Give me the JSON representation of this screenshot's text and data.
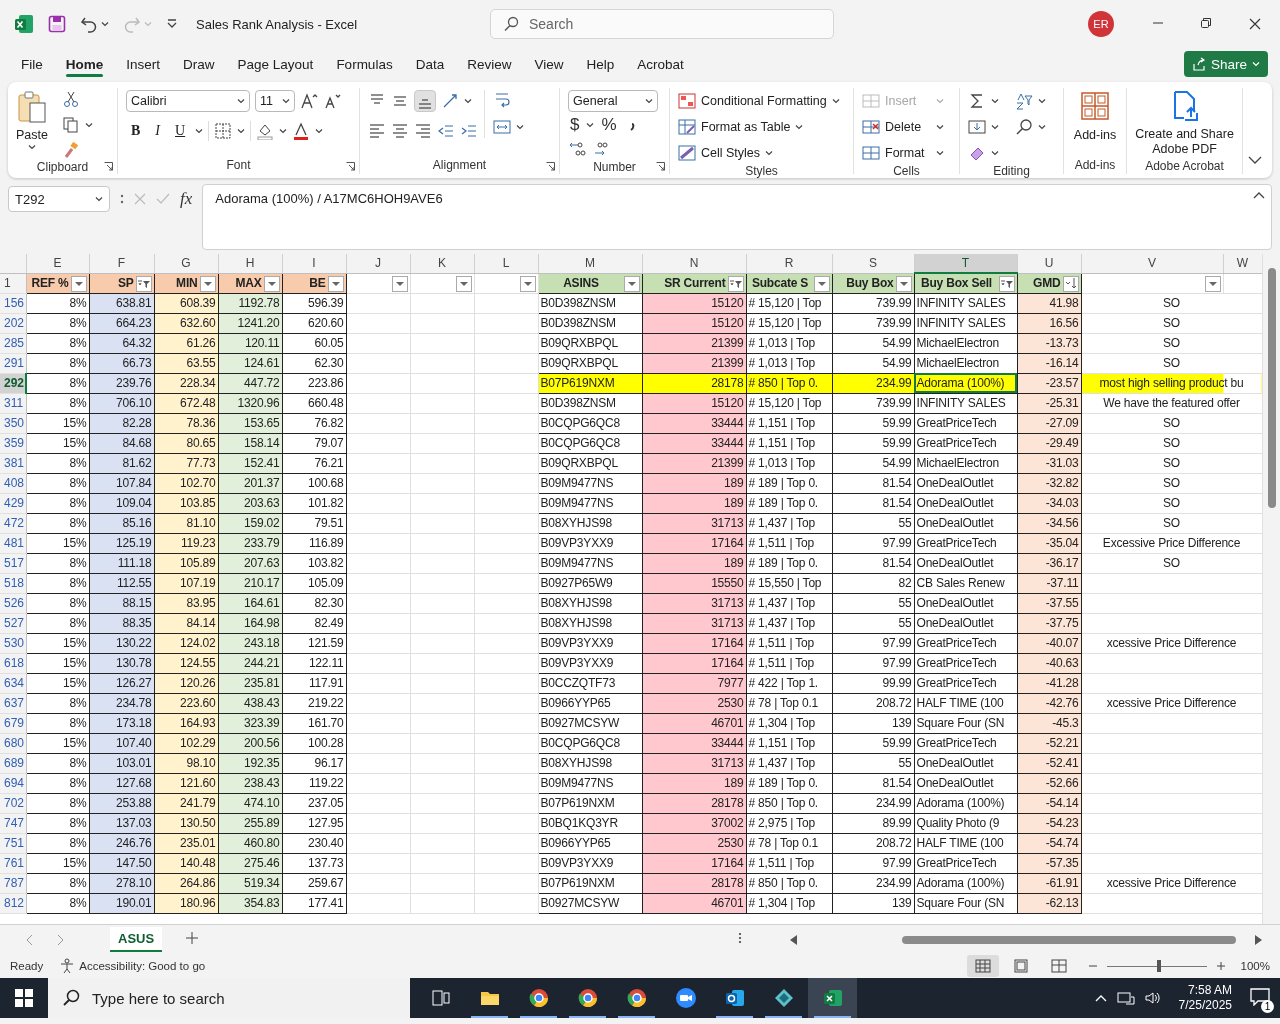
{
  "titlebar": {
    "title": "Sales Rank Analysis - Excel",
    "undo": {
      "disabled": false
    },
    "redo": {
      "disabled": true
    },
    "search_placeholder": "Search",
    "avatar": "ER"
  },
  "tabs": [
    {
      "label": "File",
      "selected": false
    },
    {
      "label": "Home",
      "selected": true
    },
    {
      "label": "Insert",
      "selected": false
    },
    {
      "label": "Draw",
      "selected": false
    },
    {
      "label": "Page Layout",
      "selected": false
    },
    {
      "label": "Formulas",
      "selected": false
    },
    {
      "label": "Data",
      "selected": false
    },
    {
      "label": "Review",
      "selected": false
    },
    {
      "label": "View",
      "selected": false
    },
    {
      "label": "Help",
      "selected": false
    },
    {
      "label": "Acrobat",
      "selected": false
    }
  ],
  "share": "Share",
  "ribbon": {
    "clipboard": {
      "label": "Clipboard",
      "paste": "Paste"
    },
    "font": {
      "label": "Font",
      "name": "Calibri",
      "size": "11",
      "bold": "B",
      "italic": "I",
      "underline": "U"
    },
    "alignment": {
      "label": "Alignment"
    },
    "number": {
      "label": "Number",
      "format": "General",
      "currency": "$",
      "percent": "%"
    },
    "styles": {
      "label": "Styles",
      "items": [
        "Conditional Formatting",
        "Format as Table",
        "Cell Styles"
      ]
    },
    "cells": {
      "label": "Cells",
      "items": [
        {
          "label": "Insert",
          "disabled": true
        },
        {
          "label": "Delete",
          "disabled": false
        },
        {
          "label": "Format",
          "disabled": false
        }
      ]
    },
    "editing": {
      "label": "Editing"
    },
    "addins": {
      "label": "Add-ins",
      "button": "Add-ins"
    },
    "acrobat": {
      "label": "Adobe Acrobat",
      "button": "Create and Share Adobe PDF"
    }
  },
  "formula_bar": {
    "name_box": "T292",
    "function_label": "fx",
    "formula": "Adorama (100%) / A17MC6HOH9AVE6"
  },
  "sheet": {
    "header_row": "1",
    "column_groups": [
      {
        "color": "#f8cbad",
        "columns": [
          {
            "letter": "E",
            "header": "REF %",
            "kind": "number",
            "filterable": true,
            "filtered": false,
            "sorted": false,
            "highlightable": false,
            "selected": false
          },
          {
            "letter": "F",
            "header": "SP",
            "kind": "number",
            "filterable": true,
            "filtered": true,
            "sorted": false,
            "color": "#d9e1f2",
            "highlightable": false,
            "selected": false
          },
          {
            "letter": "G",
            "header": "MIN",
            "kind": "number",
            "filterable": true,
            "filtered": false,
            "sorted": false,
            "color": "#fff2cc",
            "highlightable": false,
            "selected": false
          },
          {
            "letter": "H",
            "header": "MAX",
            "kind": "number",
            "filterable": true,
            "filtered": false,
            "sorted": false,
            "color": "#e2efda",
            "highlightable": false,
            "selected": false
          },
          {
            "letter": "I",
            "header": "BE",
            "kind": "number",
            "filterable": true,
            "filtered": false,
            "sorted": false,
            "highlightable": false,
            "selected": false
          }
        ]
      },
      {
        "columns": [
          {
            "letter": "J",
            "kind": "empty",
            "filterable": true,
            "filtered": false,
            "sorted": false,
            "highlightable": false,
            "selected": false
          },
          {
            "letter": "K",
            "kind": "empty",
            "filterable": true,
            "filtered": false,
            "sorted": false,
            "highlightable": false,
            "selected": false
          },
          {
            "letter": "L",
            "kind": "empty",
            "filterable": true,
            "filtered": false,
            "sorted": false,
            "highlightable": false,
            "selected": false
          }
        ]
      },
      {
        "color": "#c6e0b4",
        "columns": [
          {
            "letter": "M",
            "header": "ASINS",
            "kind": "text",
            "filterable": true,
            "filtered": false,
            "sorted": false,
            "highlightable": true,
            "selected": false
          },
          {
            "letter": "N",
            "header": "SR Current",
            "kind": "number",
            "filterable": true,
            "filtered": true,
            "sorted": false,
            "color": "#ffc7ce",
            "highlightable": true,
            "selected": false
          },
          {
            "letter": "R",
            "header": "Subcate S",
            "kind": "text",
            "filterable": true,
            "filtered": false,
            "sorted": false,
            "highlightable": true,
            "selected": false
          },
          {
            "letter": "S",
            "header": "Buy Box",
            "kind": "number",
            "filterable": true,
            "filtered": false,
            "sorted": false,
            "highlightable": true,
            "selected": false
          },
          {
            "letter": "T",
            "header": "Buy Box Sell",
            "kind": "text",
            "filterable": true,
            "filtered": true,
            "sorted": false,
            "highlightable": true,
            "selected": true
          },
          {
            "letter": "U",
            "header": "GMD",
            "kind": "number",
            "filterable": true,
            "filtered": false,
            "sorted": true,
            "color": "#fce4d6",
            "highlightable": false,
            "selected": false
          }
        ]
      },
      {
        "columns": [
          {
            "letter": "V",
            "kind": "note",
            "filterable": true,
            "filtered": false,
            "sorted": false,
            "highlightable": true,
            "selected": false
          },
          {
            "letter": "W",
            "kind": "empty",
            "filterable": false,
            "selected": false
          }
        ]
      }
    ],
    "rows": [
      {
        "row": "156",
        "cells": [
          "8%",
          "638.81",
          "608.39",
          "1192.78",
          "596.39",
          "",
          "",
          "",
          "B0D398ZNSM",
          "15120",
          "# 15,120 | Top",
          "739.99",
          "INFINITY SALES",
          "41.98",
          "SO"
        ],
        "highlighted": false,
        "selected": false
      },
      {
        "row": "202",
        "cells": [
          "8%",
          "664.23",
          "632.60",
          "1241.20",
          "620.60",
          "",
          "",
          "",
          "B0D398ZNSM",
          "15120",
          "# 15,120 | Top",
          "739.99",
          "INFINITY SALES",
          "16.56",
          "SO"
        ],
        "highlighted": false,
        "selected": false
      },
      {
        "row": "285",
        "cells": [
          "8%",
          "64.32",
          "61.26",
          "120.11",
          "60.05",
          "",
          "",
          "",
          "B09QRXBPQL",
          "21399",
          "# 1,013 | Top",
          "54.99",
          "MichaelElectron",
          "-13.73",
          "SO"
        ],
        "highlighted": false,
        "selected": false
      },
      {
        "row": "291",
        "cells": [
          "8%",
          "66.73",
          "63.55",
          "124.61",
          "62.30",
          "",
          "",
          "",
          "B09QRXBPQL",
          "21399",
          "# 1,013 | Top",
          "54.99",
          "MichaelElectron",
          "-16.14",
          "SO"
        ],
        "highlighted": false,
        "selected": false
      },
      {
        "row": "292",
        "cells": [
          "8%",
          "239.76",
          "228.34",
          "447.72",
          "223.86",
          "",
          "",
          "",
          "B07P619NXM",
          "28178",
          "# 850 | Top 0.",
          "234.99",
          "Adorama (100%)",
          "-23.57",
          "most high selling product bu"
        ],
        "highlighted": true,
        "selected": true
      },
      {
        "row": "311",
        "cells": [
          "8%",
          "706.10",
          "672.48",
          "1320.96",
          "660.48",
          "",
          "",
          "",
          "B0D398ZNSM",
          "15120",
          "# 15,120 | Top",
          "739.99",
          "INFINITY SALES",
          "-25.31",
          "We have the featured offer"
        ],
        "highlighted": false,
        "selected": false
      },
      {
        "row": "350",
        "cells": [
          "15%",
          "82.28",
          "78.36",
          "153.65",
          "76.82",
          "",
          "",
          "",
          "B0CQPG6QC8",
          "33444",
          "# 1,151 | Top",
          "59.99",
          "GreatPriceTech",
          "-27.09",
          "SO"
        ],
        "highlighted": false,
        "selected": false
      },
      {
        "row": "359",
        "cells": [
          "15%",
          "84.68",
          "80.65",
          "158.14",
          "79.07",
          "",
          "",
          "",
          "B0CQPG6QC8",
          "33444",
          "# 1,151 | Top",
          "59.99",
          "GreatPriceTech",
          "-29.49",
          "SO"
        ],
        "highlighted": false,
        "selected": false
      },
      {
        "row": "381",
        "cells": [
          "8%",
          "81.62",
          "77.73",
          "152.41",
          "76.21",
          "",
          "",
          "",
          "B09QRXBPQL",
          "21399",
          "# 1,013 | Top",
          "54.99",
          "MichaelElectron",
          "-31.03",
          "SO"
        ],
        "highlighted": false,
        "selected": false
      },
      {
        "row": "408",
        "cells": [
          "8%",
          "107.84",
          "102.70",
          "201.37",
          "100.68",
          "",
          "",
          "",
          "B09M9477NS",
          "189",
          "# 189 | Top 0.",
          "81.54",
          "OneDealOutlet",
          "-32.82",
          "SO"
        ],
        "highlighted": false,
        "selected": false
      },
      {
        "row": "429",
        "cells": [
          "8%",
          "109.04",
          "103.85",
          "203.63",
          "101.82",
          "",
          "",
          "",
          "B09M9477NS",
          "189",
          "# 189 | Top 0.",
          "81.54",
          "OneDealOutlet",
          "-34.03",
          "SO"
        ],
        "highlighted": false,
        "selected": false
      },
      {
        "row": "472",
        "cells": [
          "8%",
          "85.16",
          "81.10",
          "159.02",
          "79.51",
          "",
          "",
          "",
          "B08XYHJS98",
          "31713",
          "# 1,437 | Top",
          "55",
          "OneDealOutlet",
          "-34.56",
          "SO"
        ],
        "highlighted": false,
        "selected": false
      },
      {
        "row": "481",
        "cells": [
          "15%",
          "125.19",
          "119.23",
          "233.79",
          "116.89",
          "",
          "",
          "",
          "B09VP3YXX9",
          "17164",
          "# 1,511 | Top",
          "97.99",
          "GreatPriceTech",
          "-35.04",
          "Excessive Price Difference"
        ],
        "highlighted": false,
        "selected": false
      },
      {
        "row": "517",
        "cells": [
          "8%",
          "111.18",
          "105.89",
          "207.63",
          "103.82",
          "",
          "",
          "",
          "B09M9477NS",
          "189",
          "# 189 | Top 0.",
          "81.54",
          "OneDealOutlet",
          "-36.17",
          "SO"
        ],
        "highlighted": false,
        "selected": false
      },
      {
        "row": "518",
        "cells": [
          "8%",
          "112.55",
          "107.19",
          "210.17",
          "105.09",
          "",
          "",
          "",
          "B0927P65W9",
          "15550",
          "# 15,550 | Top",
          "82",
          "CB Sales Renew",
          "-37.11",
          ""
        ],
        "highlighted": false,
        "selected": false
      },
      {
        "row": "526",
        "cells": [
          "8%",
          "88.15",
          "83.95",
          "164.61",
          "82.30",
          "",
          "",
          "",
          "B08XYHJS98",
          "31713",
          "# 1,437 | Top",
          "55",
          "OneDealOutlet",
          "-37.55",
          ""
        ],
        "highlighted": false,
        "selected": false
      },
      {
        "row": "527",
        "cells": [
          "8%",
          "88.35",
          "84.14",
          "164.98",
          "82.49",
          "",
          "",
          "",
          "B08XYHJS98",
          "31713",
          "# 1,437 | Top",
          "55",
          "OneDealOutlet",
          "-37.75",
          ""
        ],
        "highlighted": false,
        "selected": false
      },
      {
        "row": "530",
        "cells": [
          "15%",
          "130.22",
          "124.02",
          "243.18",
          "121.59",
          "",
          "",
          "",
          "B09VP3YXX9",
          "17164",
          "# 1,511 | Top",
          "97.99",
          "GreatPriceTech",
          "-40.07",
          "xcessive Price Difference"
        ],
        "highlighted": false,
        "selected": false
      },
      {
        "row": "618",
        "cells": [
          "15%",
          "130.78",
          "124.55",
          "244.21",
          "122.11",
          "",
          "",
          "",
          "B09VP3YXX9",
          "17164",
          "# 1,511 | Top",
          "97.99",
          "GreatPriceTech",
          "-40.63",
          ""
        ],
        "highlighted": false,
        "selected": false
      },
      {
        "row": "634",
        "cells": [
          "15%",
          "126.27",
          "120.26",
          "235.81",
          "117.91",
          "",
          "",
          "",
          "B0CCZQTF73",
          "7977",
          "# 422 | Top 1.",
          "99.99",
          "GreatPriceTech",
          "-41.28",
          ""
        ],
        "highlighted": false,
        "selected": false
      },
      {
        "row": "637",
        "cells": [
          "8%",
          "234.78",
          "223.60",
          "438.43",
          "219.22",
          "",
          "",
          "",
          "B0966YYP65",
          "2530",
          "# 78 | Top 0.1",
          "208.72",
          "HALF TIME (100",
          "-42.76",
          "xcessive Price Difference"
        ],
        "highlighted": false,
        "selected": false
      },
      {
        "row": "679",
        "cells": [
          "8%",
          "173.18",
          "164.93",
          "323.39",
          "161.70",
          "",
          "",
          "",
          "B0927MCSYW",
          "46701",
          "# 1,304 | Top",
          "139",
          "Square Four (SN",
          "-45.3",
          ""
        ],
        "highlighted": false,
        "selected": false
      },
      {
        "row": "680",
        "cells": [
          "15%",
          "107.40",
          "102.29",
          "200.56",
          "100.28",
          "",
          "",
          "",
          "B0CQPG6QC8",
          "33444",
          "# 1,151 | Top",
          "59.99",
          "GreatPriceTech",
          "-52.21",
          ""
        ],
        "highlighted": false,
        "selected": false
      },
      {
        "row": "689",
        "cells": [
          "8%",
          "103.01",
          "98.10",
          "192.35",
          "96.17",
          "",
          "",
          "",
          "B08XYHJS98",
          "31713",
          "# 1,437 | Top",
          "55",
          "OneDealOutlet",
          "-52.41",
          ""
        ],
        "highlighted": false,
        "selected": false
      },
      {
        "row": "694",
        "cells": [
          "8%",
          "127.68",
          "121.60",
          "238.43",
          "119.22",
          "",
          "",
          "",
          "B09M9477NS",
          "189",
          "# 189 | Top 0.",
          "81.54",
          "OneDealOutlet",
          "-52.66",
          ""
        ],
        "highlighted": false,
        "selected": false
      },
      {
        "row": "702",
        "cells": [
          "8%",
          "253.88",
          "241.79",
          "474.10",
          "237.05",
          "",
          "",
          "",
          "B07P619NXM",
          "28178",
          "# 850 | Top 0.",
          "234.99",
          "Adorama (100%)",
          "-54.14",
          ""
        ],
        "highlighted": false,
        "selected": false
      },
      {
        "row": "747",
        "cells": [
          "8%",
          "137.03",
          "130.50",
          "255.89",
          "127.95",
          "",
          "",
          "",
          "B0BQ1KQ3YR",
          "37002",
          "# 2,975 | Top",
          "89.99",
          "Quality Photo (9",
          "-54.23",
          ""
        ],
        "highlighted": false,
        "selected": false
      },
      {
        "row": "751",
        "cells": [
          "8%",
          "246.76",
          "235.01",
          "460.80",
          "230.40",
          "",
          "",
          "",
          "B0966YYP65",
          "2530",
          "# 78 | Top 0.1",
          "208.72",
          "HALF TIME (100",
          "-54.74",
          ""
        ],
        "highlighted": false,
        "selected": false
      },
      {
        "row": "761",
        "cells": [
          "15%",
          "147.50",
          "140.48",
          "275.46",
          "137.73",
          "",
          "",
          "",
          "B09VP3YXX9",
          "17164",
          "# 1,511 | Top",
          "97.99",
          "GreatPriceTech",
          "-57.35",
          ""
        ],
        "highlighted": false,
        "selected": false
      },
      {
        "row": "787",
        "cells": [
          "8%",
          "278.10",
          "264.86",
          "519.34",
          "259.67",
          "",
          "",
          "",
          "B07P619NXM",
          "28178",
          "# 850 | Top 0.",
          "234.99",
          "Adorama (100%)",
          "-61.91",
          "xcessive Price Difference"
        ],
        "highlighted": false,
        "selected": false
      },
      {
        "row": "812",
        "cells": [
          "8%",
          "190.01",
          "180.96",
          "354.83",
          "177.41",
          "",
          "",
          "",
          "B0927MCSYW",
          "46701",
          "# 1,304 | Top",
          "139",
          "Square Four (SN",
          "-62.13",
          ""
        ],
        "highlighted": false,
        "selected": false
      }
    ]
  },
  "sheet_tabs": [
    {
      "label": "ASUS",
      "selected": true
    }
  ],
  "status_bar": {
    "status": "Ready",
    "accessibility": "Accessibility: Good to go",
    "views": [
      {
        "kind": "normal",
        "selected": true
      },
      {
        "kind": "page-layout",
        "selected": false
      },
      {
        "kind": "page-break",
        "selected": false
      }
    ],
    "zoom": {
      "level": 0.5,
      "reading": "100%"
    }
  },
  "taskbar": {
    "search_placeholder": "Type here to search",
    "apps": [
      {
        "kind": "taskview",
        "running": false,
        "active": false
      },
      {
        "kind": "folder",
        "running": true,
        "active": false
      },
      {
        "kind": "browser",
        "running": true,
        "active": false
      },
      {
        "kind": "browser",
        "running": true,
        "active": false
      },
      {
        "kind": "browser",
        "running": true,
        "active": false
      },
      {
        "kind": "video",
        "running": false,
        "active": false
      },
      {
        "kind": "mail",
        "running": true,
        "active": false
      },
      {
        "kind": "diamond",
        "running": true,
        "active": false
      },
      {
        "kind": "sheet",
        "running": true,
        "active": true
      }
    ],
    "time": "7:58 AM",
    "date": "7/25/2025",
    "notifications": "1"
  }
}
